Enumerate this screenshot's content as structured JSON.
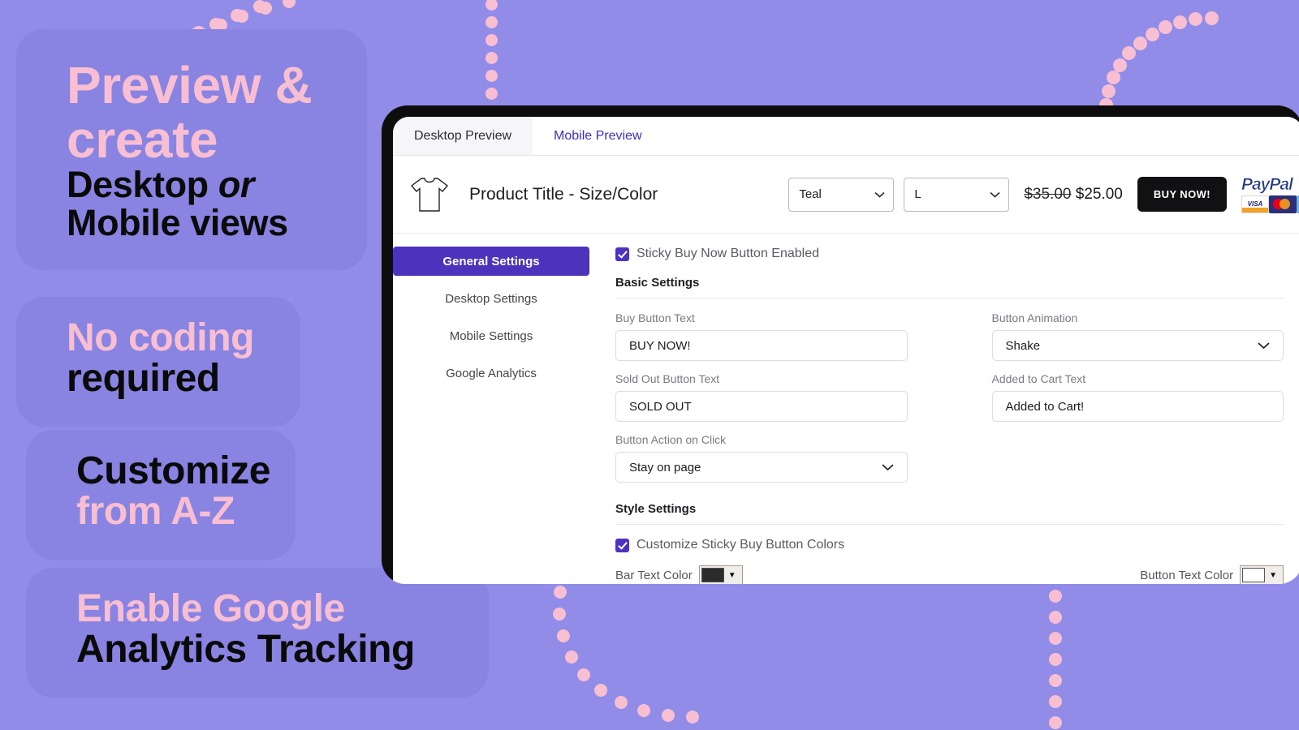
{
  "marketing": {
    "pill_preview": {
      "line1": "Preview &",
      "line2": "create",
      "line3a": "Desktop ",
      "line3b": "or",
      "line4": "Mobile views"
    },
    "pill_nocode": {
      "line1": "No coding",
      "line2": "required"
    },
    "pill_customize": {
      "line1": "Customize",
      "line2": "from A-Z"
    },
    "pill_analytics": {
      "line1": "Enable Google",
      "line2": "Analytics Tracking"
    }
  },
  "colors": {
    "background": "#908CE8",
    "pill": "#8983E2",
    "pink": "#F8BFD3",
    "black": "#0A0A0A",
    "accent_indigo": "#4C32BC",
    "tab_link": "#3B2ECC"
  },
  "preview_tabs": [
    {
      "label": "Desktop Preview",
      "active": true
    },
    {
      "label": "Mobile Preview",
      "active": false
    }
  ],
  "product_bar": {
    "icon": "tshirt-icon",
    "title": "Product Title - Size/Color",
    "color_select": {
      "value": "Teal",
      "caret": "chevron-down-icon"
    },
    "size_select": {
      "value": "L",
      "caret": "chevron-down-icon"
    },
    "price_old": "$35.00",
    "price_new": "$25.00",
    "buy_button": "BUY NOW!",
    "paypal": {
      "wordmark": "PayPal",
      "cards": [
        "VISA",
        "MasterCard",
        "Amex"
      ]
    }
  },
  "side_nav": [
    {
      "label": "General Settings",
      "active": true
    },
    {
      "label": "Desktop Settings",
      "active": false
    },
    {
      "label": "Mobile Settings",
      "active": false
    },
    {
      "label": "Google Analytics",
      "active": false
    }
  ],
  "panel": {
    "sticky_enabled": {
      "label": "Sticky Buy Now Button Enabled",
      "checked": true
    },
    "basic_settings_title": "Basic Settings",
    "fields": {
      "buy_button_text": {
        "label": "Buy Button Text",
        "value": "BUY NOW!"
      },
      "button_animation": {
        "label": "Button Animation",
        "value": "Shake",
        "caret": "chevron-down-icon"
      },
      "sold_out_button_text": {
        "label": "Sold Out Button Text",
        "value": "SOLD OUT"
      },
      "added_to_cart_text": {
        "label": "Added to Cart Text",
        "value": "Added to Cart!"
      },
      "button_action_on_click": {
        "label": "Button Action on Click",
        "value": "Stay on page",
        "caret": "chevron-down-icon"
      }
    },
    "style_settings_title": "Style Settings",
    "customize_colors": {
      "label": "Customize Sticky Buy Button Colors",
      "checked": true
    },
    "bar_text_color": {
      "label": "Bar Text Color",
      "swatch": "#2B2B2B"
    },
    "button_text_color": {
      "label": "Button Text Color",
      "swatch": "#FFFFFF"
    }
  }
}
